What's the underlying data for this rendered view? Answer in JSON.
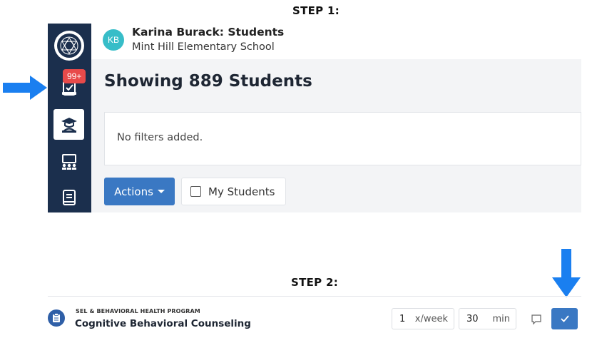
{
  "steps": {
    "step1": "STEP 1:",
    "step2": "STEP 2:"
  },
  "sidebar": {
    "badge": "99+",
    "items": [
      {
        "name": "tasks",
        "icon": "clipboard-check-icon"
      },
      {
        "name": "students",
        "icon": "student-graduate-icon",
        "active": true
      },
      {
        "name": "groups",
        "icon": "group-board-icon"
      },
      {
        "name": "library",
        "icon": "book-icon"
      }
    ]
  },
  "header": {
    "avatar_initials": "KB",
    "user_title": "Karina Burack: Students",
    "school": "Mint Hill Elementary School"
  },
  "main": {
    "title": "Showing 889 Students",
    "filters_text": "No filters added.",
    "actions_label": "Actions",
    "my_students_label": "My Students",
    "my_students_checked": false
  },
  "program": {
    "category": "SEL & BEHAVIORAL HEALTH PROGRAM",
    "name": "Cognitive Behavioral Counseling",
    "frequency_value": "1",
    "frequency_unit": "x/week",
    "duration_value": "30",
    "duration_unit": "min"
  },
  "colors": {
    "sidebar": "#1b2f4d",
    "accent": "#3a78c3",
    "badge": "#e84a4a",
    "avatar": "#37bdc8",
    "arrow": "#1a7ff0"
  }
}
